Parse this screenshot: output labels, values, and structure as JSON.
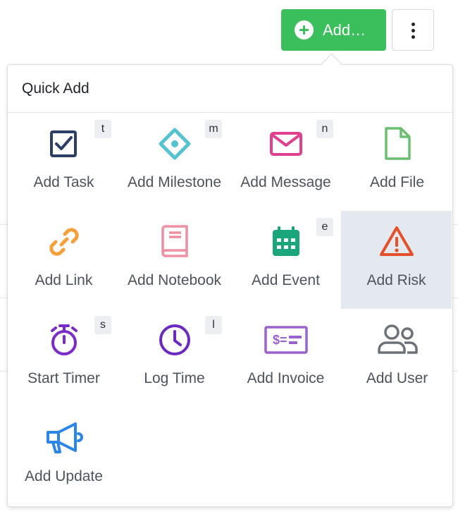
{
  "toolbar": {
    "add_label": "Add…",
    "more_icon": "kebab-vertical-icon"
  },
  "quick_add": {
    "title": "Quick Add",
    "items": [
      {
        "label": "Add Task",
        "shortcut": "t",
        "icon": "checkbox-icon",
        "color": "#2d3e66"
      },
      {
        "label": "Add Milestone",
        "shortcut": "m",
        "icon": "milestone-diamond-icon",
        "color": "#55c2cf"
      },
      {
        "label": "Add Message",
        "shortcut": "n",
        "icon": "envelope-icon",
        "color": "#e0408f"
      },
      {
        "label": "Add File",
        "shortcut": "",
        "icon": "file-icon",
        "color": "#6cbf70"
      },
      {
        "label": "Add Link",
        "shortcut": "",
        "icon": "link-icon",
        "color": "#f5a03a"
      },
      {
        "label": "Add Notebook",
        "shortcut": "",
        "icon": "notebook-icon",
        "color": "#ef8fa3"
      },
      {
        "label": "Add Event",
        "shortcut": "e",
        "icon": "calendar-icon",
        "color": "#1aa67a"
      },
      {
        "label": "Add Risk",
        "shortcut": "",
        "icon": "warning-triangle-icon",
        "color": "#e4502a",
        "active": true
      },
      {
        "label": "Start Timer",
        "shortcut": "s",
        "icon": "stopwatch-icon",
        "color": "#7a2bc8"
      },
      {
        "label": "Log Time",
        "shortcut": "l",
        "icon": "clock-icon",
        "color": "#6a2ac0"
      },
      {
        "label": "Add Invoice",
        "shortcut": "",
        "icon": "invoice-icon",
        "color": "#9a62cc"
      },
      {
        "label": "Add User",
        "shortcut": "",
        "icon": "users-icon",
        "color": "#6d7178"
      },
      {
        "label": "Add Update",
        "shortcut": "",
        "icon": "megaphone-icon",
        "color": "#2c86e8"
      }
    ]
  }
}
